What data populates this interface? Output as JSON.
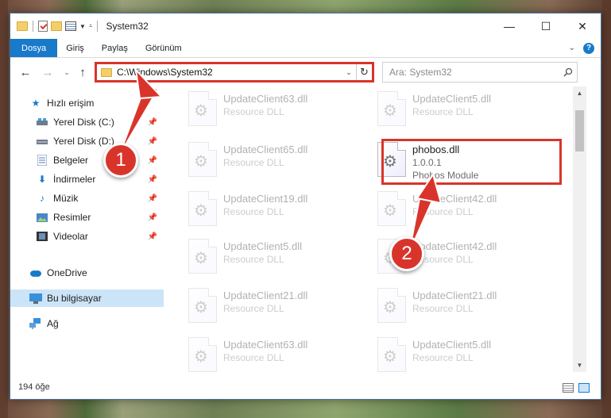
{
  "window": {
    "title": "System32",
    "controls": {
      "minimize": "—",
      "maximize": "☐",
      "close": "✕"
    }
  },
  "ribbon": {
    "tabs": [
      {
        "label": "Dosya",
        "active": true
      },
      {
        "label": "Giriş",
        "active": false
      },
      {
        "label": "Paylaş",
        "active": false
      },
      {
        "label": "Görünüm",
        "active": false
      }
    ],
    "help_label": "?"
  },
  "address": {
    "path": "C:\\Windows\\System32"
  },
  "search": {
    "placeholder": "Ara: System32"
  },
  "sidebar": {
    "items": [
      {
        "label": "Hızlı erişim",
        "icon": "star-icon",
        "pinned": false
      },
      {
        "label": "Yerel Disk (C:)",
        "icon": "drive-icon",
        "pinned": true
      },
      {
        "label": "Yerel Disk (D:)",
        "icon": "drive-icon",
        "pinned": true
      },
      {
        "label": "Belgeler",
        "icon": "documents-icon",
        "pinned": true
      },
      {
        "label": "İndirmeler",
        "icon": "download-icon",
        "pinned": true
      },
      {
        "label": "Müzik",
        "icon": "music-icon",
        "pinned": true
      },
      {
        "label": "Resimler",
        "icon": "pictures-icon",
        "pinned": true
      },
      {
        "label": "Videolar",
        "icon": "videos-icon",
        "pinned": true
      },
      {
        "label": "OneDrive",
        "icon": "cloud-icon",
        "pinned": false
      },
      {
        "label": "Bu bilgisayar",
        "icon": "computer-icon",
        "pinned": false,
        "selected": true
      },
      {
        "label": "Ağ",
        "icon": "network-icon",
        "pinned": false
      }
    ]
  },
  "files": [
    {
      "name": "UpdateClient63.dll",
      "line2": "Resource DLL",
      "line3": ""
    },
    {
      "name": "UpdateClient5.dll",
      "line2": "Resource DLL",
      "line3": ""
    },
    {
      "name": "UpdateClient65.dll",
      "line2": "Resource DLL",
      "line3": ""
    },
    {
      "name": "phobos.dll",
      "line2": "1.0.0.1",
      "line3": "Phobos Module"
    },
    {
      "name": "UpdateClient19.dll",
      "line2": "Resource DLL",
      "line3": ""
    },
    {
      "name": "UpdateClient42.dll",
      "line2": "Resource DLL",
      "line3": ""
    },
    {
      "name": "UpdateClient5.dll",
      "line2": "Resource DLL",
      "line3": ""
    },
    {
      "name": "UpdateClient42.dll",
      "line2": "Resource DLL",
      "line3": ""
    },
    {
      "name": "UpdateClient21.dll",
      "line2": "Resource DLL",
      "line3": ""
    },
    {
      "name": "UpdateClient21.dll",
      "line2": "Resource DLL",
      "line3": ""
    },
    {
      "name": "UpdateClient63.dll",
      "line2": "Resource DLL",
      "line3": ""
    },
    {
      "name": "UpdateClient5.dll",
      "line2": "Resource DLL",
      "line3": ""
    }
  ],
  "status": {
    "item_count": "194 öğe"
  },
  "markers": [
    {
      "label": "1"
    },
    {
      "label": "2"
    }
  ],
  "colors": {
    "accent": "#1979ca",
    "highlight_red": "#d9342b",
    "selection": "#cce4f7"
  }
}
